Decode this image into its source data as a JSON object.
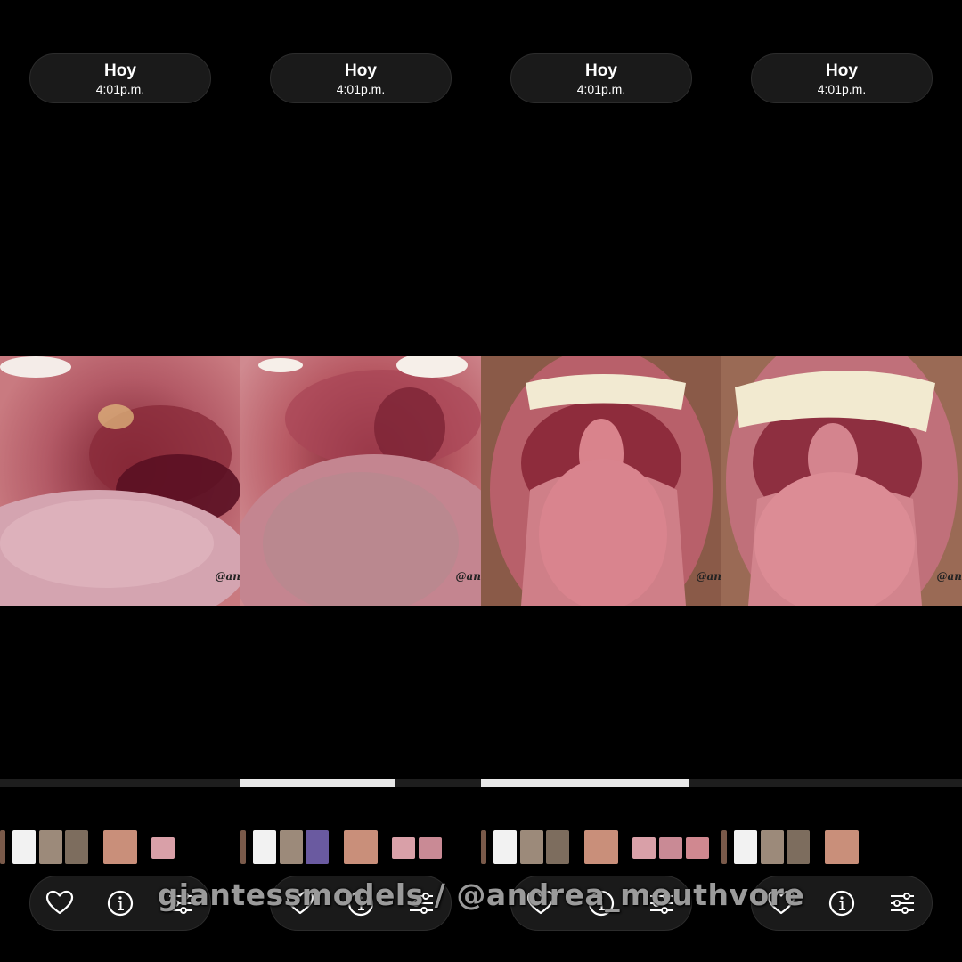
{
  "panels": [
    {
      "header": {
        "day": "Hoy",
        "time": "4:01p.m."
      },
      "watermark": "@an",
      "progress": 0.0,
      "photo_view": "closeup-throat-left",
      "thumb_tones": [
        "#7a5a4a",
        "#f2f2f2",
        "#9c8a7a",
        "#7d6d5e",
        "#c98f7a",
        "#d9a0a8"
      ]
    },
    {
      "header": {
        "day": "Hoy",
        "time": "4:01p.m."
      },
      "watermark": "@an",
      "progress": 0.645,
      "photo_view": "closeup-throat",
      "thumb_tones": [
        "#7a5a4a",
        "#f2f2f2",
        "#9c8a7a",
        "#6a5aa0",
        "#c98f7a",
        "#d9a0a8",
        "#c98a95"
      ]
    },
    {
      "header": {
        "day": "Hoy",
        "time": "4:01p.m."
      },
      "watermark": "@an",
      "progress": 0.863,
      "photo_view": "open-mouth-tongue",
      "thumb_tones": [
        "#7a5a4a",
        "#f2f2f2",
        "#9c8a7a",
        "#7d6d5e",
        "#c98f7a",
        "#d9a0a8",
        "#c98a95",
        "#d08890"
      ]
    },
    {
      "header": {
        "day": "Hoy",
        "time": "4:01p.m."
      },
      "watermark": "@an",
      "progress": 0.0,
      "photo_view": "open-mouth-tongue-wide",
      "thumb_tones": [
        "#7a5a4a",
        "#f2f2f2",
        "#9c8a7a",
        "#7d6d5e",
        "#c98f7a"
      ]
    }
  ],
  "actions": {
    "favorite_icon": "heart-icon",
    "info_icon": "info-icon",
    "adjust_icon": "sliders-icon"
  },
  "overlay": {
    "text": "giantessmodels / @andrea_mouthvore"
  },
  "colors": {
    "background": "#000000",
    "pill": "#1a1a1a",
    "progress_fill": "#e8e8e8",
    "overlay_text": "#9a9a9a"
  }
}
